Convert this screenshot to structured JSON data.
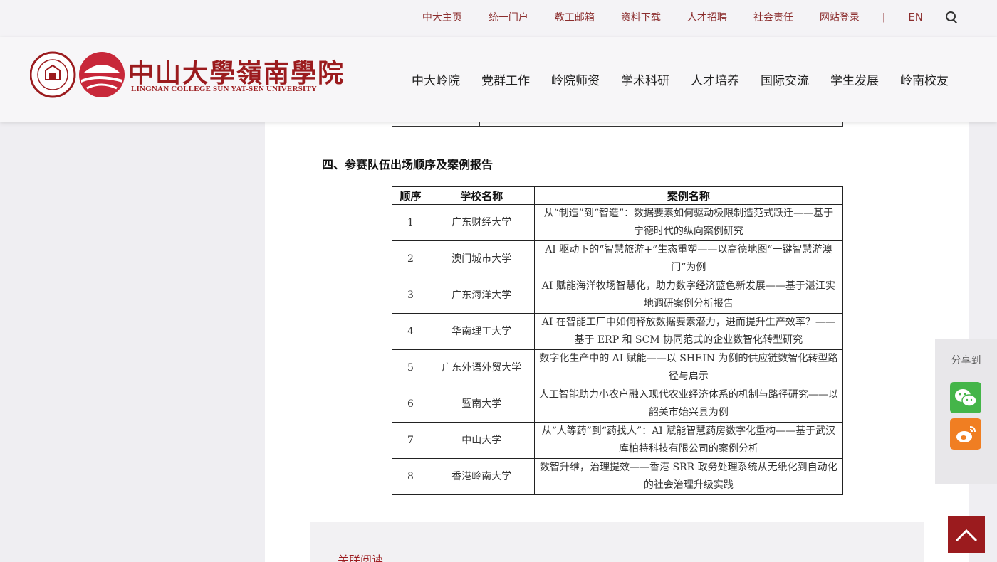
{
  "topbar": {
    "links": [
      "中大主页",
      "统一门户",
      "教工邮箱",
      "资料下载",
      "人才招聘",
      "社会责任",
      "网站登录"
    ],
    "divider": "|",
    "lang": "EN"
  },
  "logo": {
    "cn": "中山大學嶺南學院",
    "en": "LINGNAN COLLEGE SUN YAT-SEN UNIVERSITY"
  },
  "nav": [
    "中大岭院",
    "党群工作",
    "岭院师资",
    "学术科研",
    "人才培养",
    "国际交流",
    "学生发展",
    "岭南校友"
  ],
  "article": {
    "section_title": "四、参赛队伍出场顺序及案例报告",
    "table": {
      "headers": [
        "顺序",
        "学校名称",
        "案例名称"
      ],
      "rows": [
        {
          "order": "1",
          "school": "广东财经大学",
          "case": "从“制造”到“智造”：数据要素如何驱动极限制造范式跃迁——基于宁德时代的纵向案例研究"
        },
        {
          "order": "2",
          "school": "澳门城市大学",
          "case": "AI 驱动下的“智慧旅游+”生态重塑——以高德地图“一键智慧游澳门”为例"
        },
        {
          "order": "3",
          "school": "广东海洋大学",
          "case": "AI 赋能海洋牧场智慧化，助力数字经济蓝色新发展——基于湛江实地调研案例分析报告"
        },
        {
          "order": "4",
          "school": "华南理工大学",
          "case": "AI 在智能工厂中如何释放数据要素潜力，进而提升生产效率？——基于 ERP 和 SCM 协同范式的企业数智化转型研究"
        },
        {
          "order": "5",
          "school": "广东外语外贸大学",
          "case": "数字化生产中的 AI 赋能——以 SHEIN 为例的供应链数智化转型路径与启示"
        },
        {
          "order": "6",
          "school": "暨南大学",
          "case": "人工智能助力小农户融入现代农业经济体系的机制与路径研究——以韶关市始兴县为例"
        },
        {
          "order": "7",
          "school": "中山大学",
          "case": "从“人等药”到“药找人”：AI 赋能智慧药房数字化重构——基于武汉库柏特科技有限公司的案例分析"
        },
        {
          "order": "8",
          "school": "香港岭南大学",
          "case": "数智升维，治理提效——香港 SRR 政务处理系统从无纸化到自动化的社会治理升级实践"
        }
      ]
    },
    "related_label": "关联阅读"
  },
  "share": {
    "title": "分享到",
    "buttons": [
      "wechat-icon",
      "weibo-icon"
    ]
  },
  "colors": {
    "brand": "#9b1b1e",
    "wechat": "#44b549",
    "weibo": "#f07e22"
  }
}
